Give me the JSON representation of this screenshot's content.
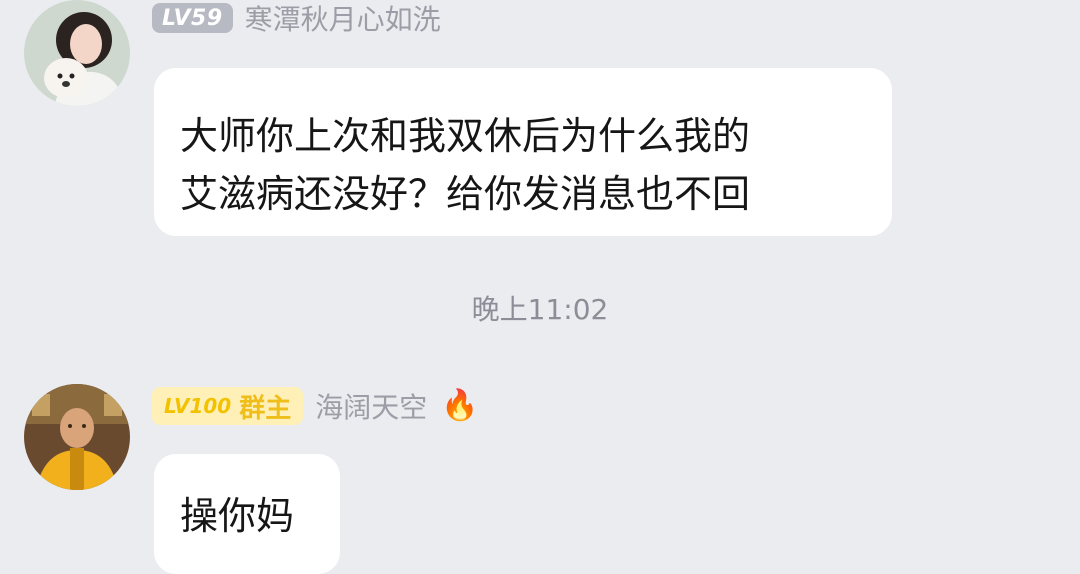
{
  "messages": [
    {
      "level_badge": "LV59",
      "nickname": "寒潭秋月心如洗",
      "lines": [
        "大师你上次和我双休后为什么我的",
        "艾滋病还没好？给你发消息也不回"
      ]
    },
    {
      "level_badge": "LV100",
      "role_badge": "群主",
      "nickname": "海阔天空",
      "emoji": "🔥",
      "text": "操你妈"
    }
  ],
  "timestamp": "晚上11:02",
  "colors": {
    "background": "#ebecf0",
    "bubble": "#ffffff",
    "owner_badge_bg": "#fff0b8",
    "owner_badge_text": "#f2c200",
    "level_badge_bg": "#b7bac3",
    "nickname": "#9b9ea6"
  }
}
